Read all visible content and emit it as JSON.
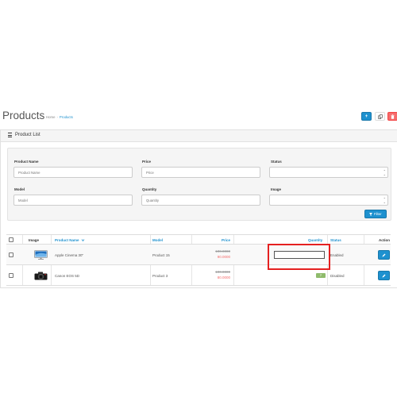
{
  "header": {
    "title": "Products",
    "breadcrumb": [
      "Home",
      "Products"
    ],
    "buttons": {
      "add_icon": "plus-icon",
      "copy_icon": "copy-icon",
      "delete_icon": "trash-icon"
    }
  },
  "panel": {
    "title": "Product List",
    "icon": "list-icon"
  },
  "filter": {
    "product_name": {
      "label": "Product Name",
      "placeholder": "Product Name"
    },
    "price": {
      "label": "Price",
      "placeholder": "Price"
    },
    "status": {
      "label": "Status",
      "value": ""
    },
    "model": {
      "label": "Model",
      "placeholder": "Model"
    },
    "quantity": {
      "label": "Quantity",
      "placeholder": "Quantity"
    },
    "image": {
      "label": "Image",
      "value": ""
    },
    "button_label": "Filter",
    "button_icon": "funnel-icon"
  },
  "table": {
    "columns": {
      "image": "Image",
      "product_name": "Product Name",
      "model": "Model",
      "price": "Price",
      "quantity": "Quantity",
      "status": "Status",
      "action": "Action"
    },
    "sort_indicator": "chevron-down-icon",
    "rows": [
      {
        "image": "monitor-thumbnail",
        "name": "Apple Cinema 30\"",
        "model": "Product 15",
        "price_old": "100.0000",
        "price_new": "90.0000",
        "quantity": "",
        "status": "Enabled"
      },
      {
        "image": "camera-thumbnail",
        "name": "Canon EOS 5D",
        "model": "Product 3",
        "price_old": "100.0000",
        "price_new": "80.0000",
        "quantity": "7",
        "status": "Disabled"
      }
    ]
  },
  "colors": {
    "primary": "#1e91cf",
    "danger": "#f56b6b",
    "success": "#8fbb6c",
    "highlight": "#e52020"
  }
}
